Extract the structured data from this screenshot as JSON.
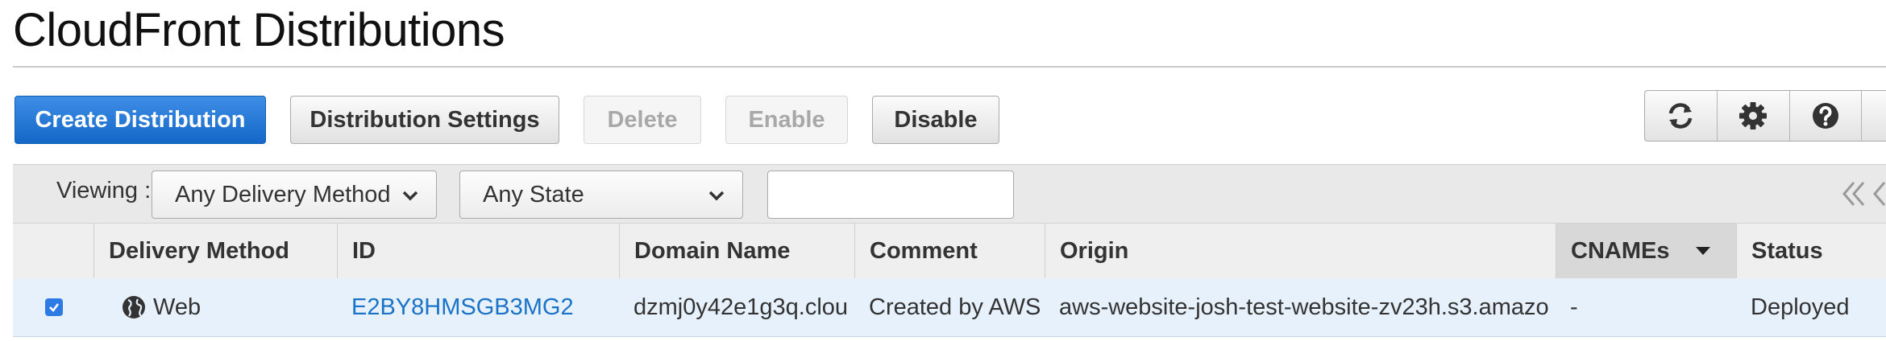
{
  "page": {
    "title": "CloudFront Distributions"
  },
  "toolbar": {
    "create_label": "Create Distribution",
    "settings_label": "Distribution Settings",
    "delete_label": "Delete",
    "enable_label": "Enable",
    "disable_label": "Disable",
    "icons": [
      "refresh-icon",
      "gear-icon",
      "help-icon"
    ]
  },
  "filters": {
    "viewing_label": "Viewing :",
    "delivery_method": "Any Delivery Method",
    "state": "Any State",
    "search_value": "",
    "search_placeholder": ""
  },
  "table": {
    "columns": [
      "Delivery Method",
      "ID",
      "Domain Name",
      "Comment",
      "Origin",
      "CNAMEs",
      "Status"
    ],
    "sorted_column": "CNAMEs",
    "rows": [
      {
        "selected": true,
        "delivery_method": "Web",
        "id": "E2BY8HMSGB3MG2",
        "domain_name": "dzmj0y42e1g3q.clou",
        "comment": "Created by AWS",
        "origin": "aws-website-josh-test-website-zv23h.s3.amazo",
        "cnames": "-",
        "status": "Deployed"
      }
    ]
  },
  "colors": {
    "primary_button": "#1467c8",
    "link": "#1a73c7",
    "selected_row": "#e6f1fb"
  }
}
